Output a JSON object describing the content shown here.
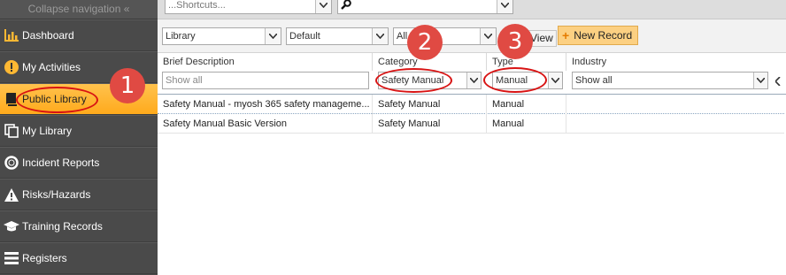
{
  "sidebar": {
    "collapse_label": "Collapse navigation «",
    "items": [
      {
        "label": "Dashboard",
        "icon": "bar-chart-icon"
      },
      {
        "label": "My Activities",
        "icon": "exclamation-icon"
      },
      {
        "label": "Public Library",
        "icon": "book-icon",
        "active": true
      },
      {
        "label": "My Library",
        "icon": "copy-icon"
      },
      {
        "label": "Incident Reports",
        "icon": "lifebuoy-icon"
      },
      {
        "label": "Risks/Hazards",
        "icon": "warning-icon"
      },
      {
        "label": "Training Records",
        "icon": "graduation-cap-icon"
      },
      {
        "label": "Registers",
        "icon": "list-icon"
      }
    ]
  },
  "topbar": {
    "shortcuts_placeholder": "...Shortcuts...",
    "search_value": ""
  },
  "toolbar": {
    "library_select": "Library",
    "view_select": "Default",
    "all_select": "All",
    "view_button": "View",
    "new_record_button": "New Record"
  },
  "grid": {
    "columns": [
      "Brief Description",
      "Category",
      "Type",
      "Industry"
    ],
    "filters": {
      "description": "Show all",
      "category": "Safety Manual",
      "type": "Manual",
      "industry": "Show all"
    },
    "rows": [
      [
        "Safety Manual - myosh 365 safety manageme...",
        "Safety Manual",
        "Manual",
        ""
      ],
      [
        "Safety Manual Basic Version",
        "Safety Manual",
        "Manual",
        ""
      ]
    ]
  },
  "annotations": [
    "1",
    "2",
    "3"
  ],
  "colors": {
    "sidebar_bg": "#4a4a4a",
    "active_item": "#ffb833",
    "annotation_red": "#d81313",
    "new_record_bg": "#fcd082"
  }
}
